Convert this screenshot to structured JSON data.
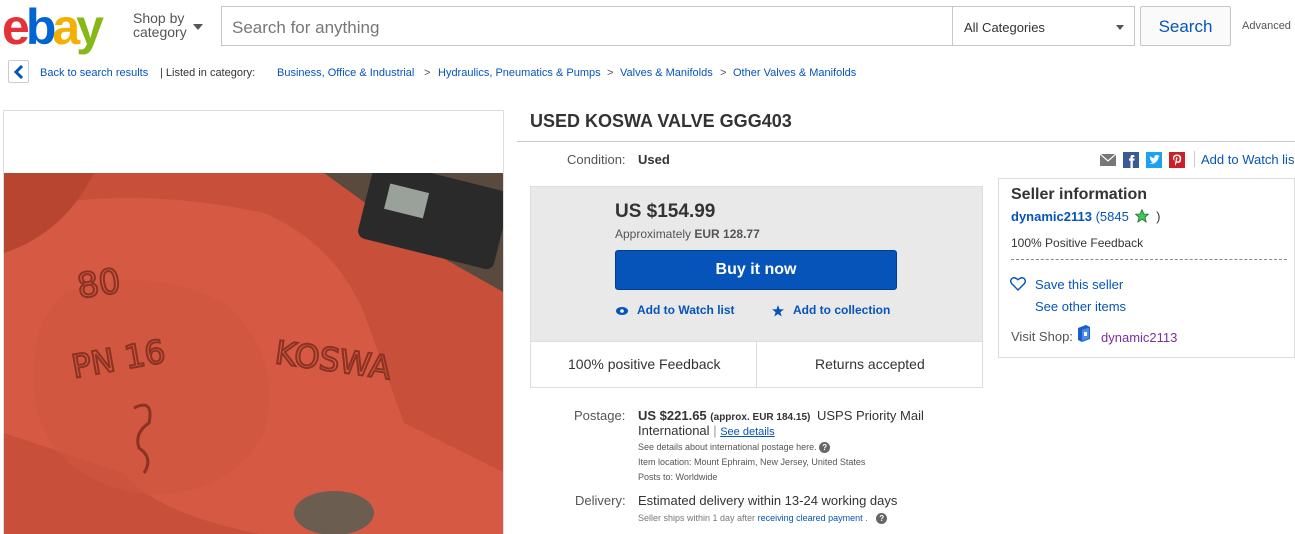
{
  "header": {
    "logo": {
      "e": "e",
      "b": "b",
      "a": "a",
      "y": "y"
    },
    "shop_by_line1": "Shop by",
    "shop_by_line2": "category",
    "search_placeholder": "Search for anything",
    "category_selected": "All Categories",
    "search_button": "Search",
    "advanced_link": "Advanced"
  },
  "breadcrumb": {
    "back": "Back to search results",
    "listed_in": "| Listed in category:",
    "crumbs": [
      "Business, Office & Industrial",
      "Hydraulics, Pneumatics & Pumps",
      "Valves & Manifolds",
      "Other Valves & Manifolds"
    ],
    "separator": ">"
  },
  "listing": {
    "title": "USED KOSWA VALVE GGG403",
    "condition_label": "Condition:",
    "condition_value": "Used",
    "watch_link": "Add to Watch lis",
    "price": "US $154.99",
    "approx_prefix": "Approximately",
    "approx_value": "EUR 128.77",
    "buy_button": "Buy it now",
    "add_watch": "Add to Watch list",
    "add_collection": "Add to collection",
    "feedback_badge": "100% positive Feedback",
    "returns_badge": "Returns accepted",
    "image": {
      "engraving_1": "80",
      "engraving_2": "PN 16",
      "engraving_3": "KOSWA"
    }
  },
  "postage": {
    "label": "Postage:",
    "amount": "US $221.65",
    "approx": "(approx. EUR 184.15)",
    "service": "USPS Priority Mail",
    "service2": "International",
    "see_details": "See details",
    "intl_note": "See details about international postage here.",
    "item_location": "Item location:  Mount Ephraim, New Jersey, United States",
    "posts_to": "Posts to:  Worldwide",
    "delivery_label": "Delivery:",
    "delivery_value": "Estimated delivery within 13-24 working days",
    "ships_note_prefix": "Seller ships within 1 day after",
    "ships_note_link": "receiving cleared payment",
    "ships_note_suffix": "."
  },
  "seller": {
    "heading": "Seller information",
    "name": "dynamic2113",
    "feedback_open": "(",
    "feedback_count": "5845",
    "feedback_close": ")",
    "positive": "100% Positive Feedback",
    "save_seller": "Save this seller",
    "other_items": "See other items",
    "visit_shop": "Visit Shop:",
    "shop_name": "dynamic2113"
  },
  "colors": {
    "ebay_red": "#e53238",
    "ebay_blue": "#0654ba",
    "ebay_yellow": "#f5af02",
    "ebay_green": "#86b817",
    "button_blue": "#0654ba"
  }
}
